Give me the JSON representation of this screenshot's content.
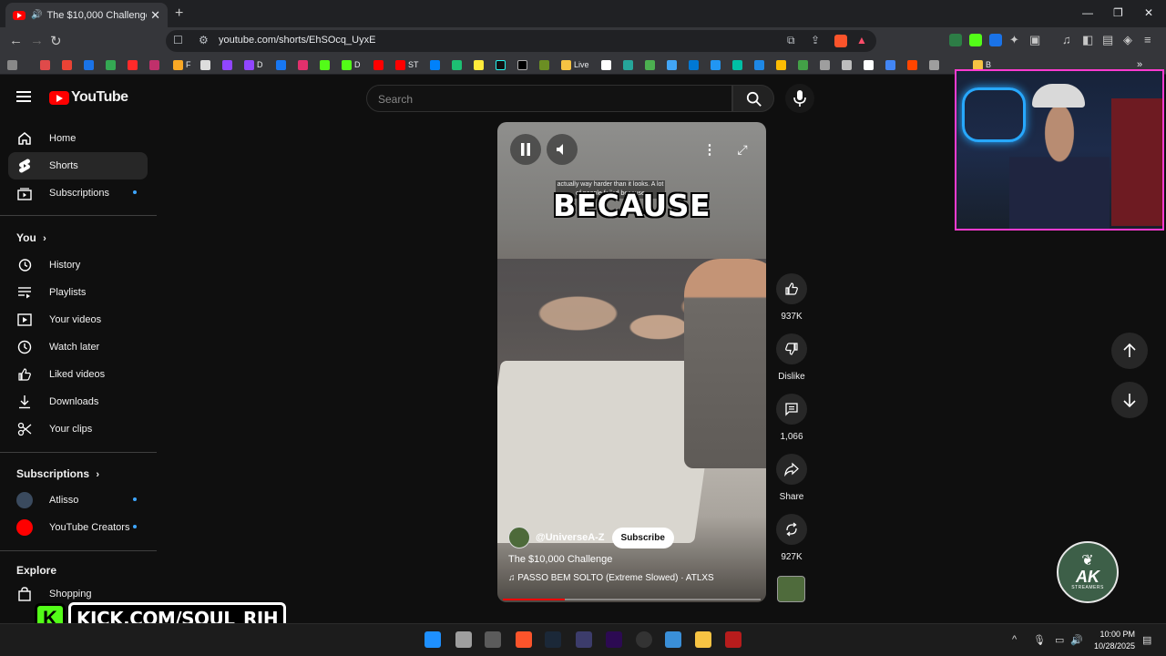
{
  "browser": {
    "tab_title": "The $10,000 Challenge - YouT",
    "url": "youtube.com/shorts/EhSOcq_UyxE",
    "new_tab": "+",
    "window_controls": [
      "—",
      "❐",
      "✕"
    ],
    "bookmarks": [
      "F",
      "D",
      "D",
      "ST",
      "Live",
      "B"
    ]
  },
  "youtube": {
    "logo_text": "YouTube",
    "search_placeholder": "Search",
    "sidebar": {
      "main": [
        {
          "label": "Home",
          "icon": "home-icon"
        },
        {
          "label": "Shorts",
          "icon": "shorts-icon",
          "active": true
        },
        {
          "label": "Subscriptions",
          "icon": "subscriptions-icon",
          "dot": true
        }
      ],
      "you_header": "You",
      "you": [
        {
          "label": "History",
          "icon": "history-icon"
        },
        {
          "label": "Playlists",
          "icon": "playlists-icon"
        },
        {
          "label": "Your videos",
          "icon": "your-videos-icon"
        },
        {
          "label": "Watch later",
          "icon": "watch-later-icon"
        },
        {
          "label": "Liked videos",
          "icon": "liked-videos-icon"
        },
        {
          "label": "Downloads",
          "icon": "downloads-icon"
        },
        {
          "label": "Your clips",
          "icon": "clips-icon"
        }
      ],
      "subs_header": "Subscriptions",
      "subs": [
        {
          "label": "Atlisso",
          "dot": true
        },
        {
          "label": "YouTube Creators",
          "dot": true
        }
      ],
      "explore_header": "Explore",
      "explore": [
        {
          "label": "Shopping",
          "icon": "shopping-icon"
        }
      ]
    },
    "short": {
      "caption_small": "actually way harder than it looks. A lot of people failed because",
      "caption_big": "BECAUSE",
      "channel": "@UniverseA-Z",
      "subscribe": "Subscribe",
      "title": "The $10,000 Challenge",
      "music": "PASSO BEM SOLTO (Extreme Slowed) · ATLXS",
      "progress": 0.24
    },
    "actions": {
      "likes": "937K",
      "dislike": "Dislike",
      "comments": "1,066",
      "share": "Share",
      "remix": "927K"
    }
  },
  "overlay": {
    "kick_text": "KICK.COM/SOUL_RIH",
    "kick_k": "K",
    "ak_text": "AK",
    "ak_sub": "STREAMERS"
  },
  "taskbar": {
    "time": "10:00 PM",
    "date": "10/28/2025"
  },
  "colors": {
    "accent": "#ff0000",
    "kick_green": "#53fc18",
    "webcam_border": "#ff3bd1"
  }
}
